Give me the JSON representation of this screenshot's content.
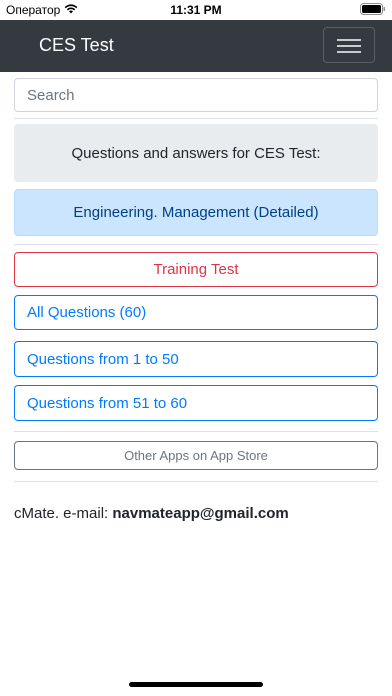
{
  "status_bar": {
    "carrier": "Оператор",
    "time": "11:31 PM"
  },
  "navbar": {
    "title": "CES Test"
  },
  "search": {
    "placeholder": "Search"
  },
  "header": {
    "text": "Questions and answers for CES Test:"
  },
  "category": {
    "text": "Engineering. Management (Detailed)"
  },
  "buttons": {
    "training": "Training Test",
    "all_questions": "All Questions (60)",
    "range_1": "Questions from 1 to 50",
    "range_2": "Questions from 51 to 60",
    "other_apps": "Other Apps on App Store"
  },
  "contact": {
    "prefix": "cMate. e-mail: ",
    "email": "navmateapp@gmail.com"
  },
  "colors": {
    "navbar": "#343a40",
    "primary": "#007bff",
    "danger": "#dc3545",
    "secondary": "#6c757d",
    "info_bg": "#cce5ff"
  }
}
